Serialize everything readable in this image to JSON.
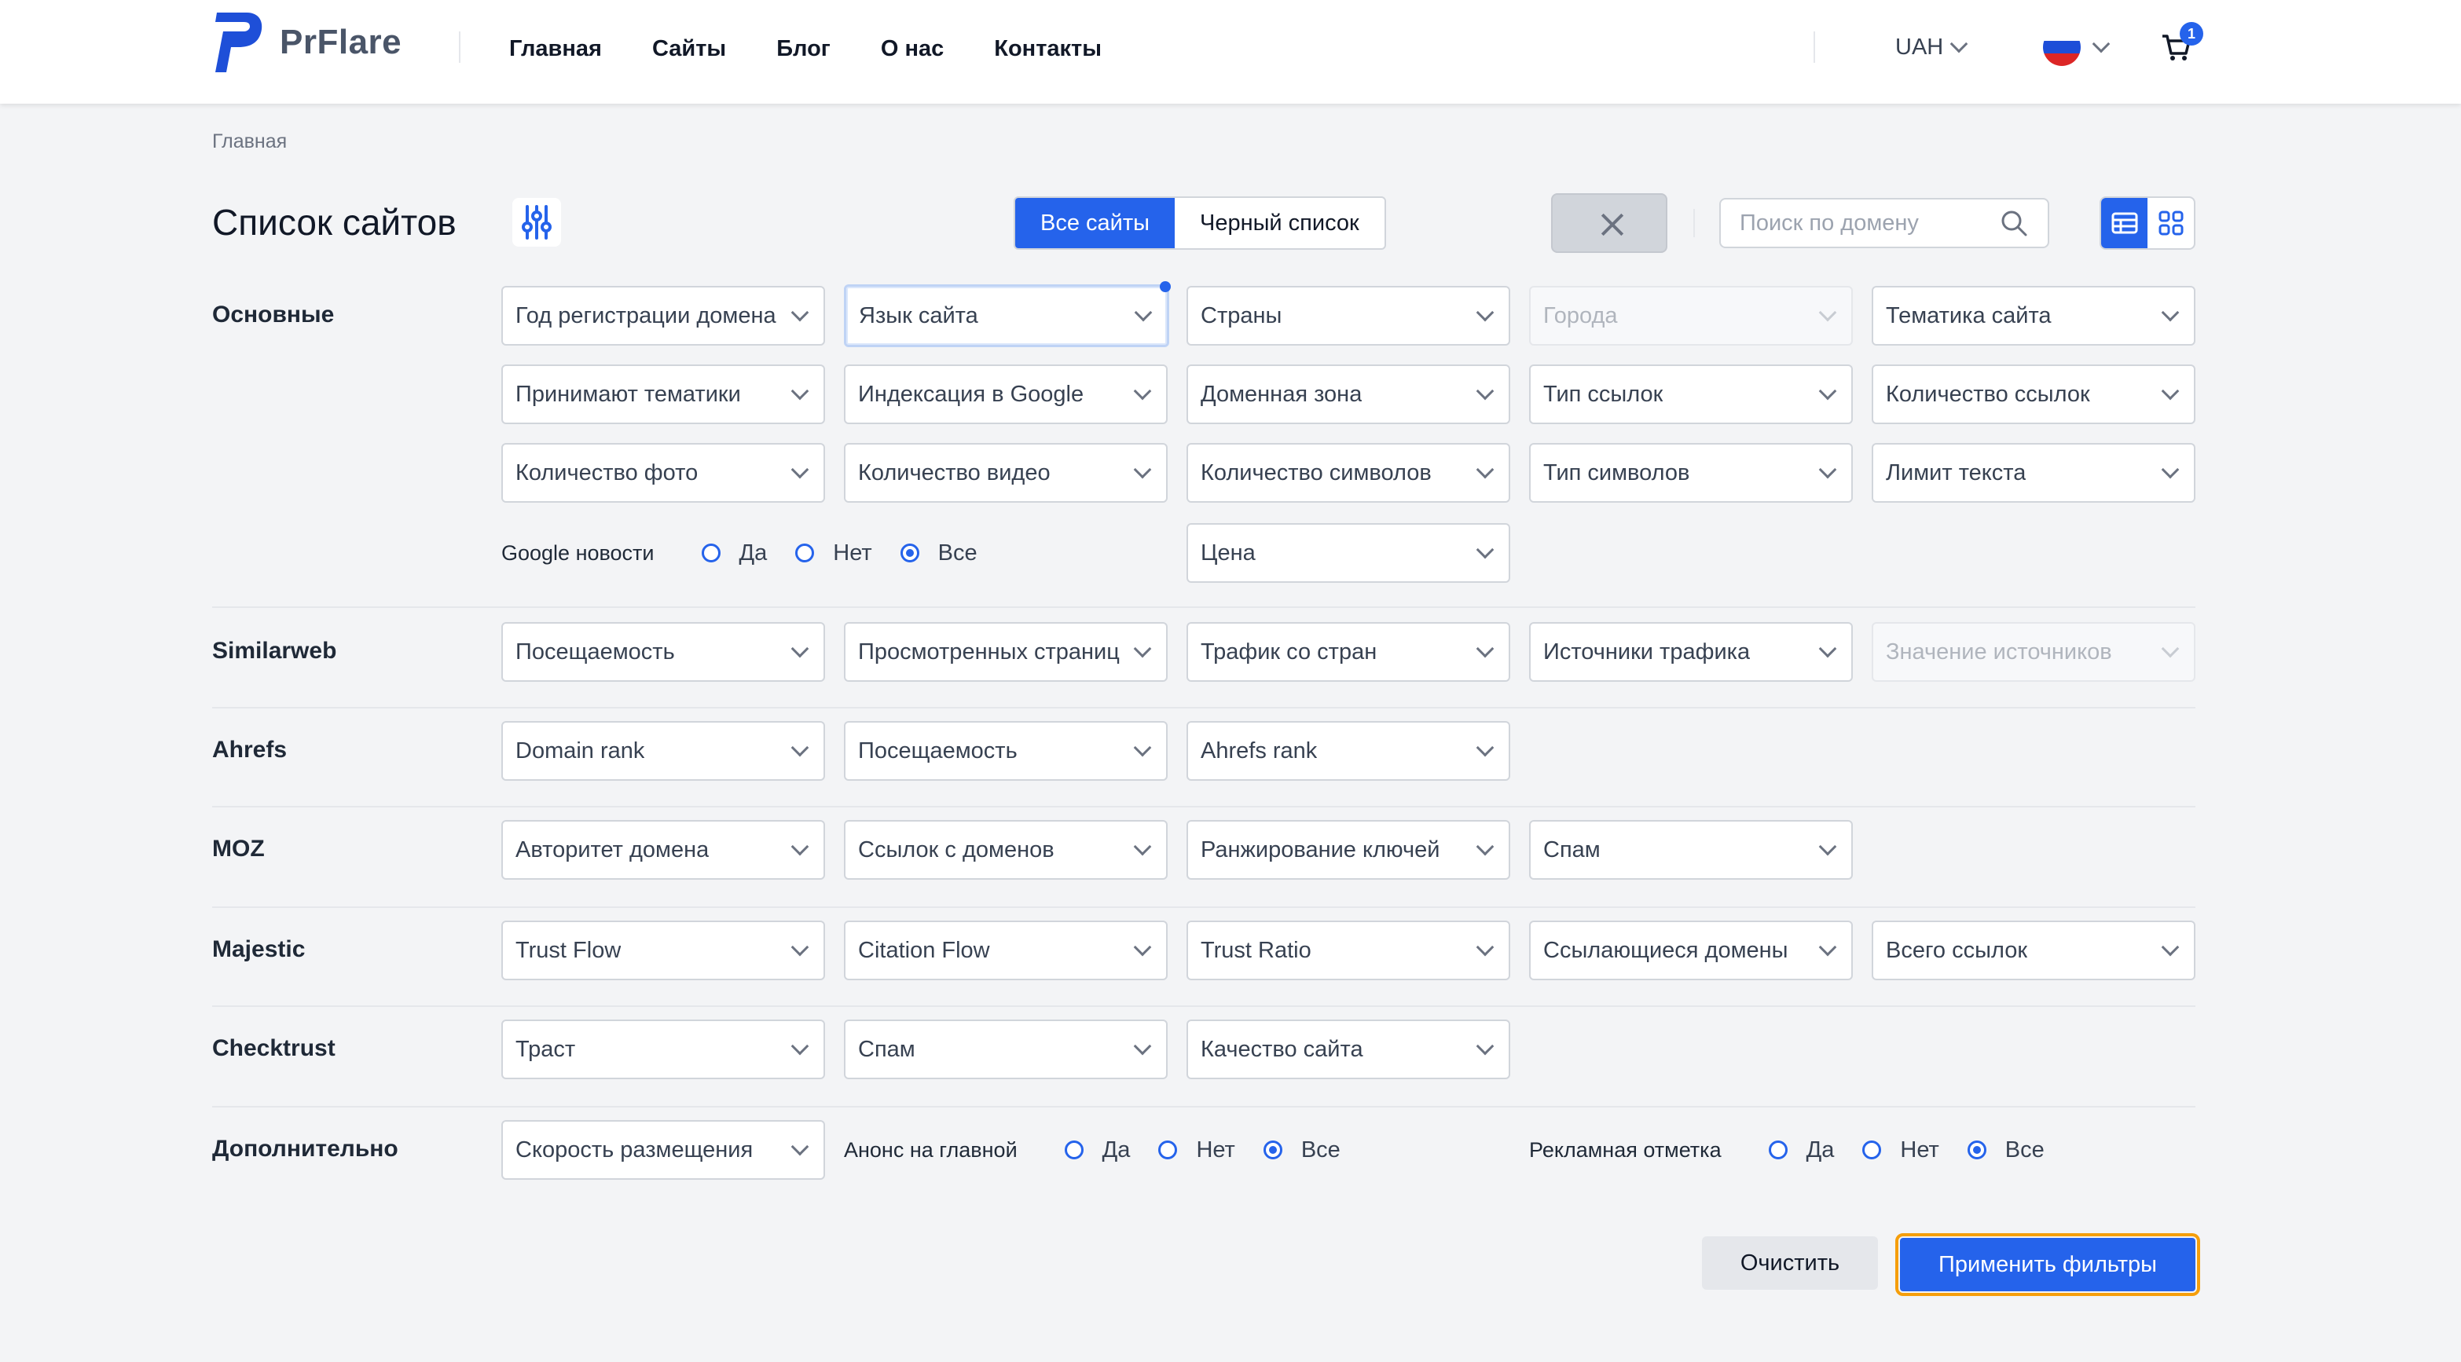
{
  "header": {
    "logo_text": "PrFlare",
    "nav": [
      "Главная",
      "Сайты",
      "Блог",
      "О нас",
      "Контакты"
    ],
    "currency": "UAH",
    "cart_count": "1",
    "colors": {
      "accent": "#2563eb",
      "flag": [
        "#ffffff",
        "#1d4ed8",
        "#dc2626"
      ]
    }
  },
  "breadcrumb": "Главная",
  "title": "Список сайтов",
  "tabs": {
    "all": "Все сайты",
    "blacklist": "Черный список"
  },
  "search": {
    "placeholder": "Поиск по домену"
  },
  "sections": {
    "basic": {
      "label": "Основные",
      "filters": [
        "Год регистрации домена",
        "Язык сайта",
        "Страны",
        "Города",
        "Тематика сайта",
        "Принимают тематики",
        "Индексация в Google",
        "Доменная зона",
        "Тип ссылок",
        "Количество ссылок",
        "Количество фото",
        "Количество видео",
        "Количество символов",
        "Тип символов",
        "Лимит текста",
        "Цена"
      ],
      "google_news": {
        "label": "Google новости",
        "options": [
          "Да",
          "Нет",
          "Все"
        ],
        "selected": "Все"
      }
    },
    "similarweb": {
      "label": "Similarweb",
      "filters": [
        "Посещаемость",
        "Просмотренных страниц",
        "Трафик со стран",
        "Источники трафика",
        "Значение источников"
      ]
    },
    "ahrefs": {
      "label": "Ahrefs",
      "filters": [
        "Domain rank",
        "Посещаемость",
        "Ahrefs rank"
      ]
    },
    "moz": {
      "label": "MOZ",
      "filters": [
        "Авторитет домена",
        "Ссылок с доменов",
        "Ранжирование ключей",
        "Спам"
      ]
    },
    "majestic": {
      "label": "Majestic",
      "filters": [
        "Trust Flow",
        "Citation Flow",
        "Trust Ratio",
        "Ссылающиеся домены",
        "Всего ссылок"
      ]
    },
    "checktrust": {
      "label": "Checktrust",
      "filters": [
        "Траст",
        "Спам",
        "Качество сайта"
      ]
    },
    "extra": {
      "label": "Дополнительно",
      "filters": [
        "Скорость размещения"
      ],
      "announce": {
        "label": "Анонс на главной",
        "options": [
          "Да",
          "Нет",
          "Все"
        ],
        "selected": "Все"
      },
      "ad_mark": {
        "label": "Рекламная отметка",
        "options": [
          "Да",
          "Нет",
          "Все"
        ],
        "selected": "Все"
      }
    }
  },
  "buttons": {
    "clear": "Очистить",
    "apply": "Применить фильтры"
  }
}
